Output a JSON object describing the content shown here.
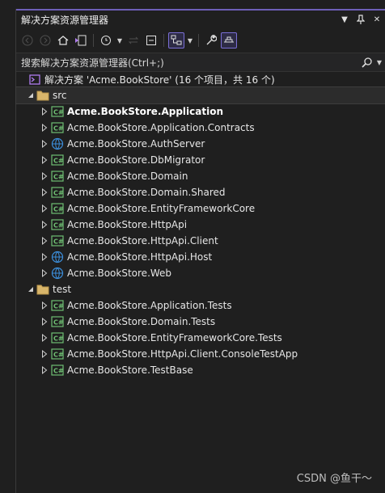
{
  "window": {
    "title": "解决方案资源管理器"
  },
  "search": {
    "placeholder": "搜索解决方案资源管理器(Ctrl+;)"
  },
  "solution": {
    "label": "解决方案 'Acme.BookStore' (16 个项目，共 16 个)"
  },
  "folders": [
    {
      "name": "src",
      "projects": [
        {
          "name": "Acme.BookStore.Application",
          "icon": "csharp-project-icon",
          "bold": true
        },
        {
          "name": "Acme.BookStore.Application.Contracts",
          "icon": "csharp-project-icon"
        },
        {
          "name": "Acme.BookStore.AuthServer",
          "icon": "web-project-icon"
        },
        {
          "name": "Acme.BookStore.DbMigrator",
          "icon": "csharp-project-icon"
        },
        {
          "name": "Acme.BookStore.Domain",
          "icon": "csharp-project-icon"
        },
        {
          "name": "Acme.BookStore.Domain.Shared",
          "icon": "csharp-project-icon"
        },
        {
          "name": "Acme.BookStore.EntityFrameworkCore",
          "icon": "csharp-project-icon"
        },
        {
          "name": "Acme.BookStore.HttpApi",
          "icon": "csharp-project-icon"
        },
        {
          "name": "Acme.BookStore.HttpApi.Client",
          "icon": "csharp-project-icon"
        },
        {
          "name": "Acme.BookStore.HttpApi.Host",
          "icon": "web-project-icon"
        },
        {
          "name": "Acme.BookStore.Web",
          "icon": "web-project-icon"
        }
      ]
    },
    {
      "name": "test",
      "projects": [
        {
          "name": "Acme.BookStore.Application.Tests",
          "icon": "csharp-project-icon"
        },
        {
          "name": "Acme.BookStore.Domain.Tests",
          "icon": "csharp-project-icon"
        },
        {
          "name": "Acme.BookStore.EntityFrameworkCore.Tests",
          "icon": "csharp-project-icon"
        },
        {
          "name": "Acme.BookStore.HttpApi.Client.ConsoleTestApp",
          "icon": "csharp-project-icon"
        },
        {
          "name": "Acme.BookStore.TestBase",
          "icon": "csharp-project-icon"
        }
      ]
    }
  ],
  "watermark": "CSDN @鱼干～",
  "colors": {
    "accent": "#7a6fd6",
    "background": "#1f1f1f",
    "folder": "#d8b56a",
    "csharp": "#6fbf73",
    "web": "#3c8fdc"
  }
}
